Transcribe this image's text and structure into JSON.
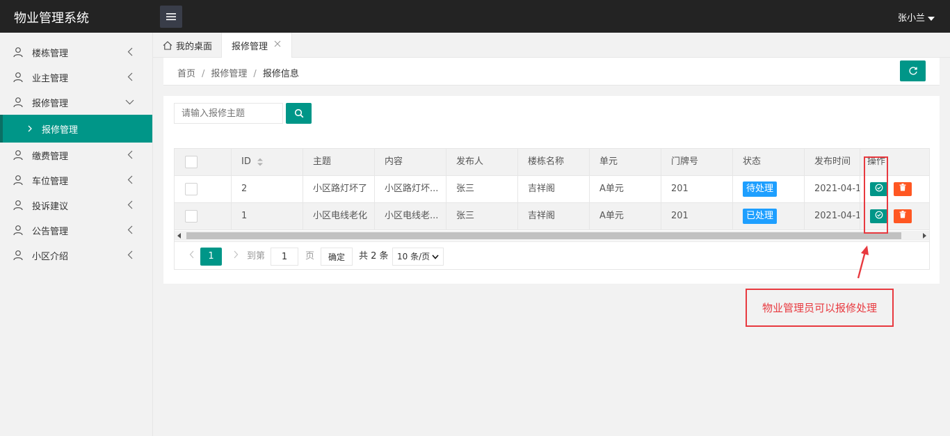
{
  "app": {
    "title": "物业管理系统",
    "user": "张小兰"
  },
  "sidebar": {
    "items": [
      {
        "label": "楼栋管理"
      },
      {
        "label": "业主管理"
      },
      {
        "label": "报修管理"
      },
      {
        "label": "报修管理"
      },
      {
        "label": "缴费管理"
      },
      {
        "label": "车位管理"
      },
      {
        "label": "投诉建议"
      },
      {
        "label": "公告管理"
      },
      {
        "label": "小区介绍"
      }
    ]
  },
  "tabs": {
    "home": "我的桌面",
    "active": "报修管理"
  },
  "breadcrumb": {
    "home": "首页",
    "section": "报修管理",
    "current": "报修信息",
    "sep": "/"
  },
  "search": {
    "placeholder": "请输入报修主题",
    "value": ""
  },
  "table": {
    "columns": [
      "ID",
      "主题",
      "内容",
      "发布人",
      "楼栋名称",
      "单元",
      "门牌号",
      "状态",
      "发布时间",
      "操作"
    ],
    "rows": [
      {
        "id": "2",
        "subject": "小区路灯坏了",
        "content": "小区路灯坏...",
        "publisher": "张三",
        "building": "吉祥阁",
        "unit": "A单元",
        "door": "201",
        "status": "待处理",
        "time": "2021-04-1..."
      },
      {
        "id": "1",
        "subject": "小区电线老化",
        "content": "小区电线老...",
        "publisher": "张三",
        "building": "吉祥阁",
        "unit": "A单元",
        "door": "201",
        "status": "已处理",
        "time": "2021-04-1..."
      }
    ]
  },
  "pagination": {
    "current_page": "1",
    "goto_label": "到第",
    "goto_value": "1",
    "page_label": "页",
    "confirm_label": "确定",
    "total_label": "共 2 条",
    "page_size": "10 条/页"
  },
  "annotation": {
    "note": "物业管理员可以报修处理"
  },
  "colors": {
    "accent": "#009688",
    "topbar": "#232323",
    "status_badge": "#1e9fff",
    "delete": "#ff5722",
    "annotation": "#e8393f"
  }
}
